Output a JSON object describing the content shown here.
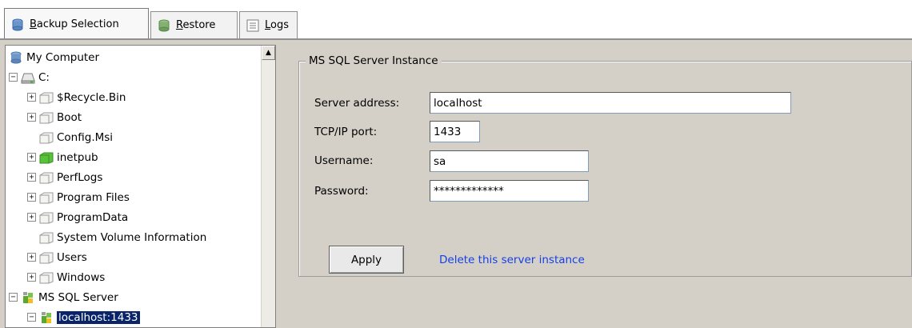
{
  "tabs": [
    {
      "label_u": "B",
      "label_rest": "ackup Selection",
      "icon": "database-icon",
      "active": true
    },
    {
      "label_u": "R",
      "label_rest": "estore",
      "icon": "database-icon",
      "active": false
    },
    {
      "label_u": "L",
      "label_rest": "ogs",
      "icon": "list-icon",
      "active": false
    }
  ],
  "tree": {
    "root": "My Computer",
    "drive": "C:",
    "folders": [
      "$Recycle.Bin",
      "Boot",
      "Config.Msi",
      "inetpub",
      "PerfLogs",
      "Program Files",
      "ProgramData",
      "System Volume Information",
      "Users",
      "Windows"
    ],
    "sql_group": "MS SQL Server",
    "sql_instance": "localhost:1433"
  },
  "instance_panel": {
    "title": "MS SQL Server Instance",
    "server_address_label": "Server address:",
    "server_address_value": "localhost",
    "port_label": "TCP/IP port:",
    "port_value": "1433",
    "username_label": "Username:",
    "username_value": "sa",
    "password_label": "Password:",
    "password_value": "*************",
    "apply_label": "Apply",
    "delete_label": "Delete this server instance"
  },
  "colors": {
    "selection": "#0a246a",
    "link": "#1440e8",
    "panel": "#d4d0c8"
  }
}
